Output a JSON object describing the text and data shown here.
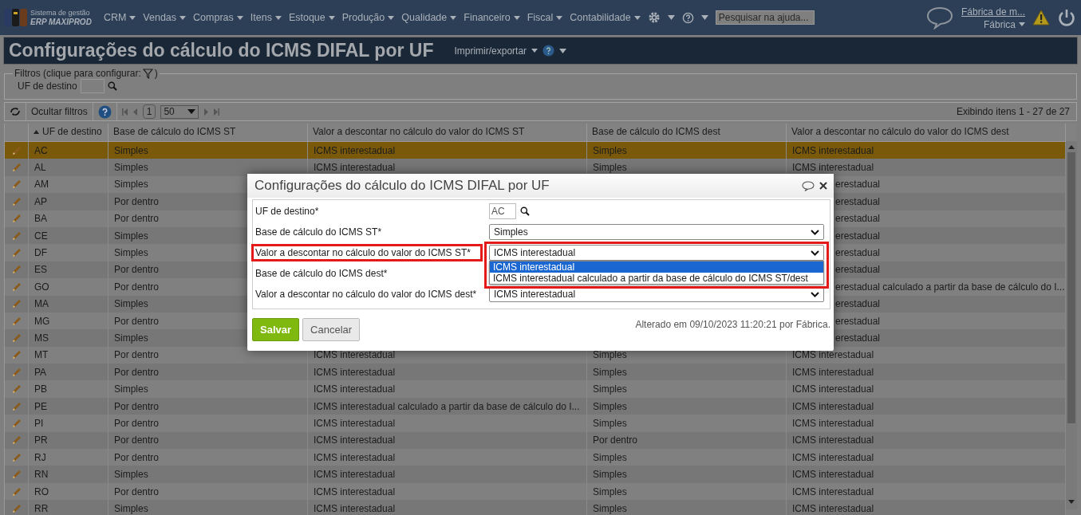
{
  "app": {
    "logo_line1": "Sistema de gestão",
    "logo_line2": "ERP MAXIPROD"
  },
  "menu": [
    "CRM",
    "Vendas",
    "Compras",
    "Itens",
    "Estoque",
    "Produção",
    "Qualidade",
    "Financeiro",
    "Fiscal",
    "Contabilidade"
  ],
  "help_search": {
    "placeholder": "Pesquisar na ajuda..."
  },
  "user": {
    "company_link": "Fábrica de m...",
    "profile": "Fábrica"
  },
  "page": {
    "title": "Configurações do cálculo do ICMS DIFAL por UF",
    "export_menu": "Imprimir/exportar"
  },
  "filters": {
    "legend": "Filtros (clique para configurar: ",
    "legend_end": ")",
    "fields": [
      {
        "label": "UF de destino"
      }
    ]
  },
  "toolbar": {
    "toggle_filters": "Ocultar filtros",
    "page": "1",
    "page_size": "50",
    "summary": "Exibindo itens 1 - 27 de 27"
  },
  "table": {
    "columns": [
      {
        "label": "UF de destino",
        "sorted": true
      },
      {
        "label": "Base de cálculo do ICMS ST",
        "sorted": false
      },
      {
        "label": "Valor a descontar no cálculo do valor do ICMS ST",
        "sorted": false
      },
      {
        "label": "Base de cálculo do ICMS dest",
        "sorted": false
      },
      {
        "label": "Valor a descontar no cálculo do valor do ICMS dest",
        "sorted": false
      }
    ],
    "rows": [
      {
        "selected": true,
        "cells": [
          "AC",
          "Simples",
          "ICMS interestadual",
          "Simples",
          "ICMS interestadual"
        ]
      },
      {
        "selected": false,
        "cells": [
          "AL",
          "Simples",
          "ICMS interestadual",
          "Simples",
          "ICMS interestadual"
        ]
      },
      {
        "selected": false,
        "cells": [
          "AM",
          "Simples",
          null,
          null,
          "erestadual"
        ]
      },
      {
        "selected": false,
        "cells": [
          "AP",
          "Por dentro",
          null,
          null,
          "erestadual"
        ]
      },
      {
        "selected": false,
        "cells": [
          "BA",
          "Por dentro",
          null,
          null,
          "erestadual"
        ]
      },
      {
        "selected": false,
        "cells": [
          "CE",
          "Simples",
          null,
          null,
          "erestadual"
        ]
      },
      {
        "selected": false,
        "cells": [
          "DF",
          "Simples",
          null,
          null,
          "erestadual"
        ]
      },
      {
        "selected": false,
        "cells": [
          "ES",
          "Por dentro",
          null,
          null,
          "erestadual"
        ]
      },
      {
        "selected": false,
        "cells": [
          "GO",
          "Por dentro",
          null,
          null,
          "erestadual calculado a partir da base de cálculo do I..."
        ]
      },
      {
        "selected": false,
        "cells": [
          "MA",
          "Simples",
          null,
          null,
          "erestadual"
        ]
      },
      {
        "selected": false,
        "cells": [
          "MG",
          "Por dentro",
          null,
          null,
          "erestadual"
        ]
      },
      {
        "selected": false,
        "cells": [
          "MS",
          "Simples",
          null,
          null,
          "erestadual"
        ]
      },
      {
        "selected": false,
        "cells": [
          "MT",
          "Por dentro",
          "ICMS interestadual",
          "Simples",
          "ICMS interestadual"
        ]
      },
      {
        "selected": false,
        "cells": [
          "PA",
          "Por dentro",
          "ICMS interestadual",
          "Simples",
          "ICMS interestadual"
        ]
      },
      {
        "selected": false,
        "cells": [
          "PB",
          "Simples",
          "ICMS interestadual",
          "Simples",
          "ICMS interestadual"
        ]
      },
      {
        "selected": false,
        "cells": [
          "PE",
          "Por dentro",
          "ICMS interestadual calculado a partir da base de cálculo do I...",
          "Simples",
          "ICMS interestadual"
        ]
      },
      {
        "selected": false,
        "cells": [
          "PI",
          "Por dentro",
          "ICMS interestadual",
          "Simples",
          "ICMS interestadual"
        ]
      },
      {
        "selected": false,
        "cells": [
          "PR",
          "Por dentro",
          "ICMS interestadual",
          "Por dentro",
          "ICMS interestadual"
        ]
      },
      {
        "selected": false,
        "cells": [
          "RJ",
          "Por dentro",
          "ICMS interestadual",
          "Simples",
          "ICMS interestadual"
        ]
      },
      {
        "selected": false,
        "cells": [
          "RN",
          "Simples",
          "ICMS interestadual",
          "Simples",
          "ICMS interestadual"
        ]
      },
      {
        "selected": false,
        "cells": [
          "RO",
          "Por dentro",
          "ICMS interestadual",
          "Simples",
          "ICMS interestadual"
        ]
      },
      {
        "selected": false,
        "cells": [
          "RR",
          "Simples",
          "ICMS interestadual",
          "Simples",
          "ICMS interestadual"
        ]
      }
    ]
  },
  "dialog": {
    "title": "Configurações do cálculo do ICMS DIFAL por UF",
    "fields": [
      {
        "kind": "lookup",
        "label": "UF de destino*",
        "value": "AC",
        "highlighted": false
      },
      {
        "kind": "select",
        "label": "Base de cálculo do ICMS ST*",
        "value": "Simples",
        "highlighted": false
      },
      {
        "kind": "select",
        "label": "Valor a descontar no cálculo do valor do ICMS ST*",
        "value": "ICMS interestadual",
        "highlighted": true,
        "expanded": true,
        "options": [
          {
            "label": "ICMS interestadual",
            "selected": true
          },
          {
            "label": "ICMS interestadual calculado a partir da base de cálculo do ICMS ST/dest",
            "selected": false
          }
        ]
      },
      {
        "kind": "select",
        "label": "Base de cálculo do ICMS dest*",
        "highlighted": false
      },
      {
        "kind": "select",
        "label": "Valor a descontar no cálculo do valor do ICMS dest*",
        "value": "ICMS interestadual",
        "highlighted": false
      }
    ],
    "buttons": [
      {
        "label": "Salvar",
        "kind": "primary"
      },
      {
        "label": "Cancelar",
        "kind": "secondary"
      }
    ],
    "audit": "Alterado em 09/10/2023 11:20:21 por Fábrica."
  }
}
